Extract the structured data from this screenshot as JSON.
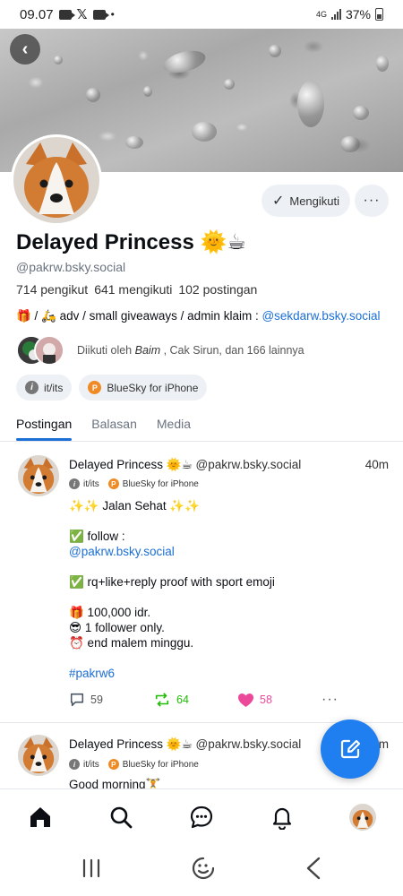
{
  "status_bar": {
    "time": "09.07",
    "x_label": "𝕏",
    "dot": "•",
    "network": "4G",
    "battery": "37%"
  },
  "profile": {
    "back_glyph": "‹",
    "display_name": "Delayed Princess 🌞☕",
    "handle": "@pakrw.bsky.social",
    "following_button": "Mengikuti",
    "more_glyph": "···",
    "stats": {
      "followers": "714 pengikut",
      "following": "641 mengikuti",
      "posts": "102 postingan"
    },
    "bio_prefix": "🎁 / 🛵 adv / small giveaways / admin klaim : ",
    "bio_link": "@sekdarw.bsky.social",
    "followed_by_prefix": "Diikuti oleh ",
    "followed_by_name": "Baim",
    "followed_by_suffix": " , Cak Sirun, dan 166 lainnya",
    "chips": [
      {
        "label": "it/its",
        "icon": "i"
      },
      {
        "label": "BlueSky for iPhone",
        "icon": "P"
      }
    ]
  },
  "tabs": [
    {
      "label": "Postingan",
      "active": true
    },
    {
      "label": "Balasan",
      "active": false
    },
    {
      "label": "Media",
      "active": false
    }
  ],
  "posts": [
    {
      "author": "Delayed Princess 🌞☕",
      "handle": "@pakrw.bsky.social",
      "time": "40m",
      "chips": [
        "it/its",
        "BlueSky for iPhone"
      ],
      "lines": [
        "✨✨ Jalan Sehat ✨✨",
        "",
        "✅ follow :",
        "@pakrw.bsky.social",
        "",
        "✅ rq+like+reply proof with sport emoji",
        "",
        "🎁 100,000 idr.",
        "😎 1 follower only.",
        "⏰ end malem minggu.",
        "",
        "#pakrw6"
      ],
      "replies": "59",
      "reposts": "64",
      "likes": "58",
      "more": "···"
    },
    {
      "author": "Delayed Princess 🌞☕",
      "handle": "@pakrw.bsky.social",
      "time": "1m",
      "chips": [
        "it/its",
        "BlueSky for iPhone"
      ],
      "lines": [
        "Good morning🏋️"
      ]
    }
  ],
  "colors": {
    "accent": "#1b6fd6",
    "fab": "#1f7ef0",
    "repost": "#20bc07",
    "like": "#ec4899"
  },
  "icons": [
    "back-icon",
    "check-icon",
    "home-icon",
    "search-icon",
    "chat-icon",
    "bell-icon",
    "compose-icon",
    "reply-icon",
    "repost-icon",
    "heart-icon"
  ]
}
